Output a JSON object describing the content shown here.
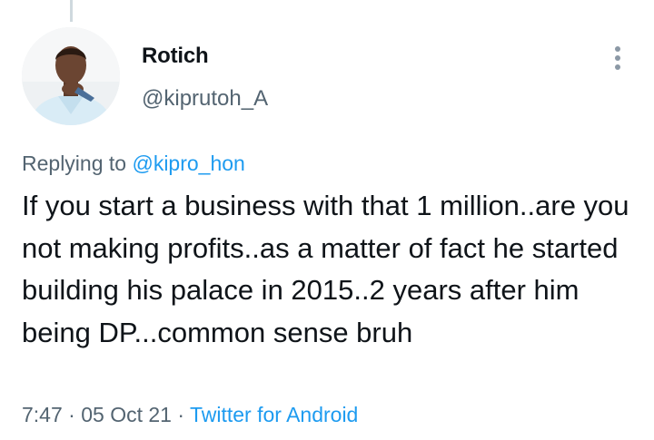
{
  "tweet": {
    "author": {
      "display_name": "Rotich",
      "handle": "@kiprutoh_A"
    },
    "reply": {
      "prefix": "Replying to ",
      "target_handle": "@kipro_hon"
    },
    "text": "If you start a business with that 1 million..are you not making profits..as a matter of fact he started building his palace in 2015..2 years after him being DP...common sense bruh",
    "meta": {
      "time": "7:47",
      "separator": " · ",
      "date": "05 Oct 21",
      "source": "Twitter for Android"
    }
  },
  "icons": {
    "avatar": "user-photo",
    "more": "more-vertical-icon"
  },
  "colors": {
    "link": "#1d9bf0",
    "secondary_text": "#536471",
    "primary_text": "#0f1419",
    "thread_line": "#cfd9de"
  }
}
